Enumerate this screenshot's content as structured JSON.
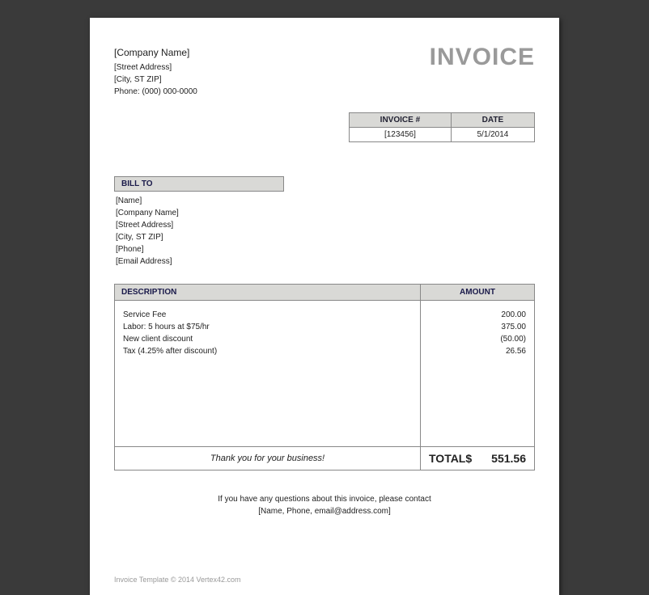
{
  "company": {
    "name": "[Company Name]",
    "street": "[Street Address]",
    "city_st_zip": "[City, ST ZIP]",
    "phone": "Phone: (000) 000-0000"
  },
  "title": "INVOICE",
  "meta": {
    "invoice_num_label": "INVOICE #",
    "date_label": "DATE",
    "invoice_num": "[123456]",
    "date": "5/1/2014"
  },
  "billto": {
    "header": "BILL TO",
    "lines": {
      "name": "[Name]",
      "company": "[Company Name]",
      "street": "[Street Address]",
      "city_st_zip": "[City, ST  ZIP]",
      "phone": "[Phone]",
      "email": "[Email Address]"
    }
  },
  "items": {
    "desc_header": "DESCRIPTION",
    "amount_header": "AMOUNT",
    "rows": [
      {
        "desc": "Service Fee",
        "amount": "200.00"
      },
      {
        "desc": "Labor: 5 hours at $75/hr",
        "amount": "375.00"
      },
      {
        "desc": "New client discount",
        "amount": "(50.00)"
      },
      {
        "desc": "Tax (4.25% after discount)",
        "amount": "26.56"
      }
    ]
  },
  "total": {
    "thanks": "Thank you for your business!",
    "label": "TOTAL",
    "currency": "$",
    "amount": "551.56"
  },
  "footer": {
    "line1": "If you have any questions about this invoice, please contact",
    "line2": "[Name, Phone, email@address.com]"
  },
  "copyright": "Invoice Template © 2014 Vertex42.com"
}
